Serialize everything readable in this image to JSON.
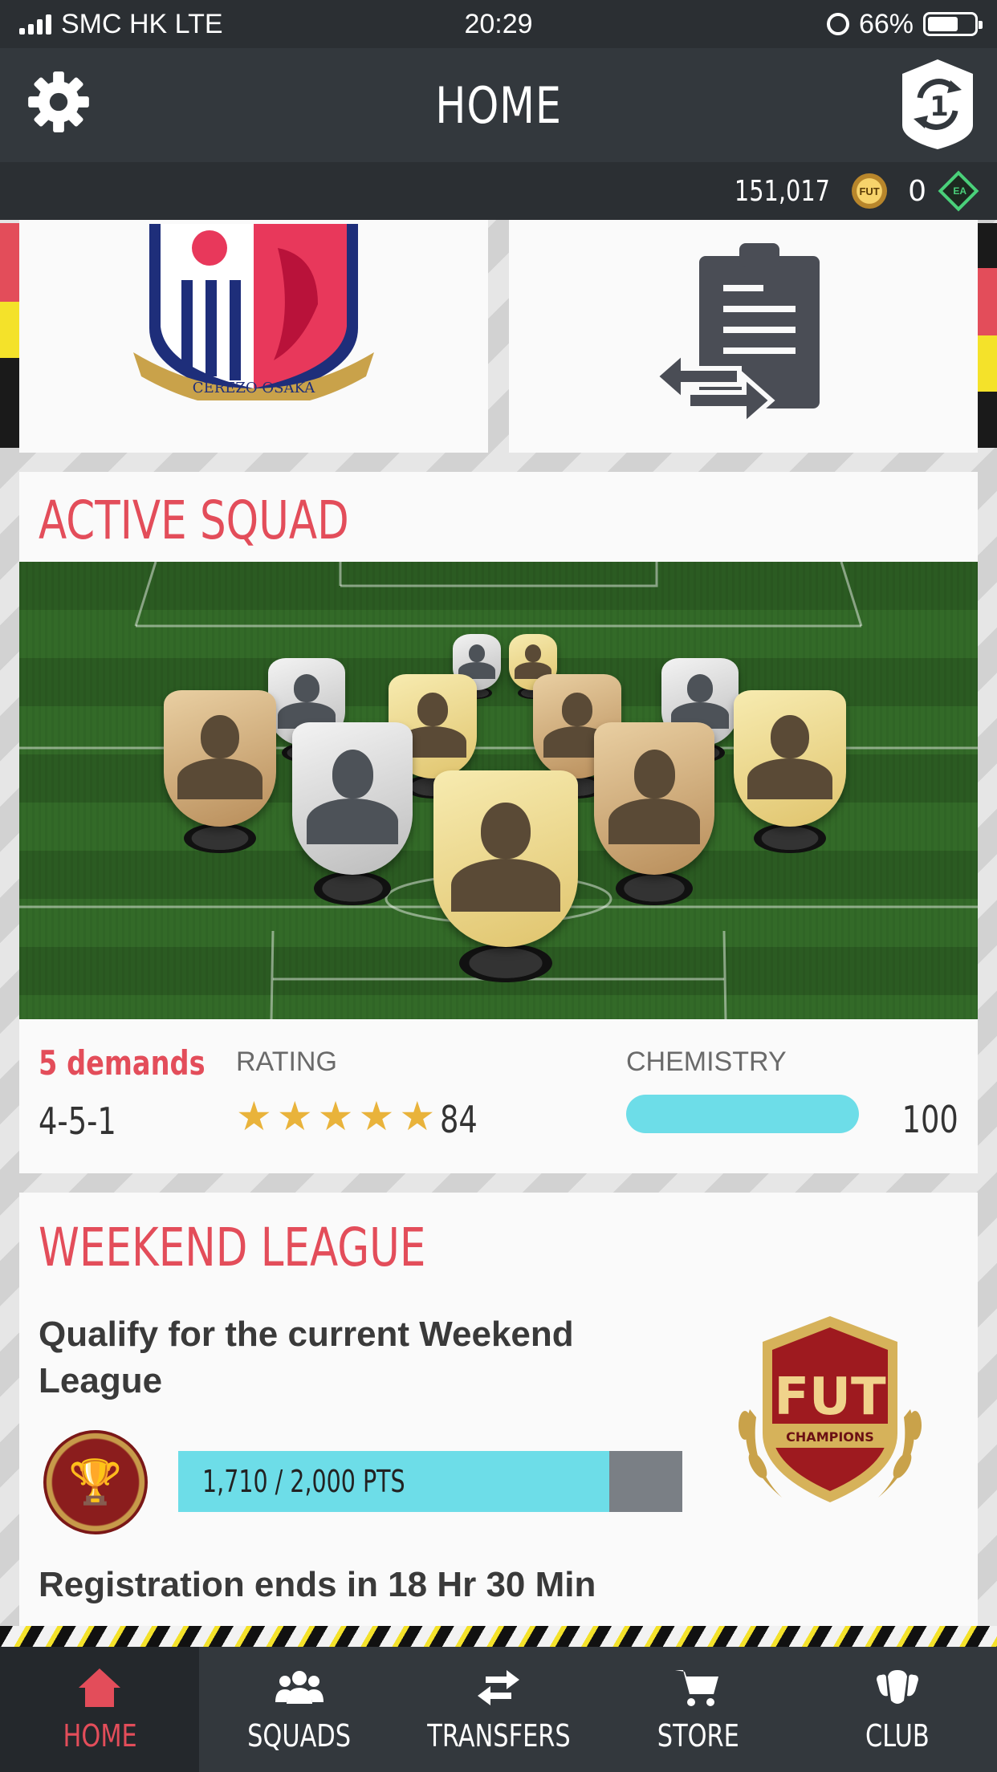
{
  "status_bar": {
    "carrier": "SMC HK  LTE",
    "time": "20:29",
    "battery": "66%",
    "battery_level": 0.66
  },
  "header": {
    "title": "HOME",
    "sync_badge": "1"
  },
  "currency": {
    "coins": "151,017",
    "coin_label": "FUT",
    "points": "0",
    "points_label": "EA"
  },
  "tiles": {
    "club_crest_text": "CEREZO OSAKA"
  },
  "active_squad": {
    "title": "ACTIVE SQUAD",
    "demands": "5 demands",
    "formation": "4-5-1",
    "rating_label": "RATING",
    "rating_value": "84",
    "stars": 5,
    "chemistry_label": "CHEMISTRY",
    "chemistry_value": "100",
    "chemistry_fraction": 1.0
  },
  "weekend_league": {
    "title": "WEEKEND LEAGUE",
    "description": "Qualify for the current Weekend League",
    "progress_label": "1,710 / 2,000 PTS",
    "progress_fraction": 0.855,
    "registration": "Registration ends in 18 Hr 30 Min",
    "badge_text": "FUT",
    "badge_subtext": "CHAMPIONS"
  },
  "nav": [
    {
      "label": "HOME",
      "icon": "home-icon",
      "active": true
    },
    {
      "label": "SQUADS",
      "icon": "squads-icon",
      "active": false
    },
    {
      "label": "TRANSFERS",
      "icon": "transfers-icon",
      "active": false
    },
    {
      "label": "STORE",
      "icon": "cart-icon",
      "active": false
    },
    {
      "label": "CLUB",
      "icon": "club-icon",
      "active": false
    }
  ],
  "colors": {
    "accent": "#e34d5a",
    "progress": "#6ddde8",
    "header": "#33383d"
  }
}
